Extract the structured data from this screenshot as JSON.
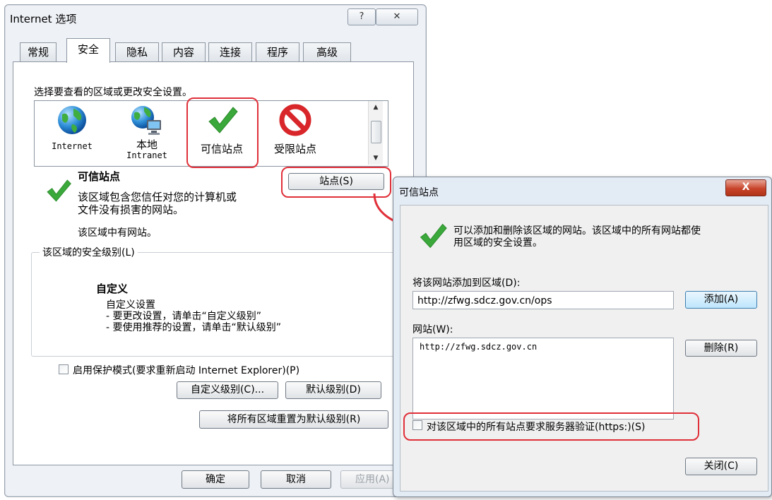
{
  "internet_options": {
    "title": "Internet 选项",
    "help_label": "?",
    "close_label": "✕",
    "tabs": [
      {
        "label": "常规",
        "active": false
      },
      {
        "label": "安全",
        "active": true
      },
      {
        "label": "隐私",
        "active": false
      },
      {
        "label": "内容",
        "active": false
      },
      {
        "label": "连接",
        "active": false
      },
      {
        "label": "程序",
        "active": false
      },
      {
        "label": "高级",
        "active": false
      }
    ],
    "zone_prompt": "选择要查看的区域或更改安全设置。",
    "zones": [
      {
        "label": "Internet",
        "icon": "globe-icon"
      },
      {
        "label": "本地",
        "sublabel": "Intranet",
        "icon": "local-intranet-icon"
      },
      {
        "label": "可信站点",
        "icon": "checkmark-icon",
        "selected": true
      },
      {
        "label": "受限站点",
        "icon": "no-entry-icon"
      }
    ],
    "zone_desc_title": "可信站点",
    "zone_desc_line1": "该区域包含您信任对您的计算机或",
    "zone_desc_line2": "文件没有损害的网站。",
    "zone_desc_note": "该区域中有网站。",
    "sites_button": "站点(S)",
    "security_level_group": "该区域的安全级别(L)",
    "level_name": "自定义",
    "level_lines": [
      "自定义设置",
      "- 要更改设置，请单击“自定义级别”",
      "- 要使用推荐的设置，请单击“默认级别”"
    ],
    "protected_mode_label": "启用保护模式(要求重新启动 Internet Explorer)(P)",
    "protected_mode_checked": false,
    "custom_level_button": "自定义级别(C)...",
    "default_level_button": "默认级别(D)",
    "reset_all_button": "将所有区域重置为默认级别(R)",
    "ok_button": "确定",
    "cancel_button": "取消",
    "apply_button": "应用(A)"
  },
  "trusted_sites": {
    "title": "可信站点",
    "close_label": "X",
    "intro_line1": "可以添加和删除该区域的网站。该区域中的所有网站都使",
    "intro_line2": "用区域的安全设置。",
    "add_label": "将该网站添加到区域(D):",
    "url_value": "http://zfwg.sdcz.gov.cn/ops",
    "add_button": "添加(A)",
    "sites_label": "网站(W):",
    "sites": [
      "http://zfwg.sdcz.gov.cn"
    ],
    "remove_button": "删除(R)",
    "https_label": "对该区域中的所有站点要求服务器验证(https:)(S)",
    "https_checked": false,
    "close_button": "关闭(C)"
  },
  "colors": {
    "annotation_red": "#e0303a",
    "check_green": "#3aa83a",
    "no_entry_red": "#d8262a"
  }
}
